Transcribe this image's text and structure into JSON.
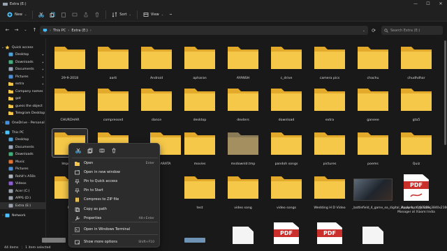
{
  "window": {
    "tab_title": "Extra (E:)",
    "controls": {
      "minimize": "—",
      "maximize": "☐",
      "close": "✕"
    }
  },
  "toolbar": {
    "new_label": "New",
    "sort_label": "Sort",
    "view_label": "View",
    "more_label": "···"
  },
  "address": {
    "crumbs": [
      "This PC",
      "Extra (E:)"
    ],
    "search_placeholder": "Search Extra (E:)"
  },
  "sidebar": {
    "items": [
      {
        "label": "Quick access",
        "icon": "star-icon"
      },
      {
        "label": "Desktop",
        "icon": "desktop-icon",
        "pinned": true
      },
      {
        "label": "Downloads",
        "icon": "downloads-icon",
        "pinned": true
      },
      {
        "label": "Documents",
        "icon": "documents-icon",
        "pinned": true
      },
      {
        "label": "Pictures",
        "icon": "pictures-icon",
        "pinned": true
      },
      {
        "label": "extra",
        "icon": "folder-icon",
        "pinned": true
      },
      {
        "label": "Company names",
        "icon": "folder-icon"
      },
      {
        "label": "got",
        "icon": "folder-icon"
      },
      {
        "label": "guess the object",
        "icon": "folder-icon"
      },
      {
        "label": "Telegram Desktop",
        "icon": "folder-icon"
      },
      {
        "label": "OneDrive - Personal",
        "icon": "cloud-icon"
      },
      {
        "label": "This PC",
        "icon": "pc-icon"
      },
      {
        "label": "Desktop",
        "icon": "desktop-icon"
      },
      {
        "label": "Documents",
        "icon": "documents-icon"
      },
      {
        "label": "Downloads",
        "icon": "downloads-icon"
      },
      {
        "label": "Music",
        "icon": "music-icon"
      },
      {
        "label": "Pictures",
        "icon": "pictures-icon"
      },
      {
        "label": "Rohit's A50s",
        "icon": "phone-icon"
      },
      {
        "label": "Videos",
        "icon": "videos-icon"
      },
      {
        "label": "Acer (C:)",
        "icon": "drive-icon"
      },
      {
        "label": "APPS (D:)",
        "icon": "drive-icon"
      },
      {
        "label": "Extra (E:)",
        "icon": "drive-icon",
        "selected": true
      },
      {
        "label": "Network",
        "icon": "network-icon"
      }
    ]
  },
  "files": {
    "row1": [
      "29-9-2018",
      "aarti",
      "Android",
      "apharan",
      "AYANSH",
      "c_drive",
      "camera pics",
      "chachu",
      "chudhdhar"
    ],
    "row2": [
      "CHURDHAR",
      "compressed",
      "dance",
      "desktop",
      "dexters",
      "download",
      "extra",
      "ganeee",
      "gta5"
    ],
    "row3": [
      "Important",
      "",
      "",
      "ARATA",
      "movies",
      "msdownld.tmp",
      "pandoh songs",
      "pictures",
      "poems",
      "Quiz"
    ],
    "row4": [
      "RC",
      "",
      "",
      "",
      "test",
      "video song",
      "video songs",
      "Wedding H D Video",
      "_battlefield_4_game_ea_digital_illusions_ce_93159_3840x2160",
      "Apply for City Sales Manager at Xiaomi India"
    ]
  },
  "context_menu": {
    "items": [
      {
        "label": "Open",
        "shortcut": "Enter"
      },
      {
        "label": "Open in new window",
        "shortcut": ""
      },
      {
        "label": "Pin to Quick access",
        "shortcut": ""
      },
      {
        "label": "Pin to Start",
        "shortcut": ""
      },
      {
        "label": "Compress to ZIP file",
        "shortcut": ""
      },
      {
        "label": "Copy as path",
        "shortcut": ""
      },
      {
        "label": "Properties",
        "shortcut": "Alt+Enter"
      },
      {
        "label": "Open in Windows Terminal",
        "shortcut": ""
      },
      {
        "label": "Show more options",
        "shortcut": "Shift+F10"
      }
    ]
  },
  "status": {
    "count": "44 items",
    "selection": "1 item selected"
  },
  "pdf_badge": "PDF",
  "colors": {
    "folder": "#f6c849",
    "folder_back": "#e3a92b",
    "accent": "#4cc2ff",
    "pdf_red": "#c9302c"
  }
}
